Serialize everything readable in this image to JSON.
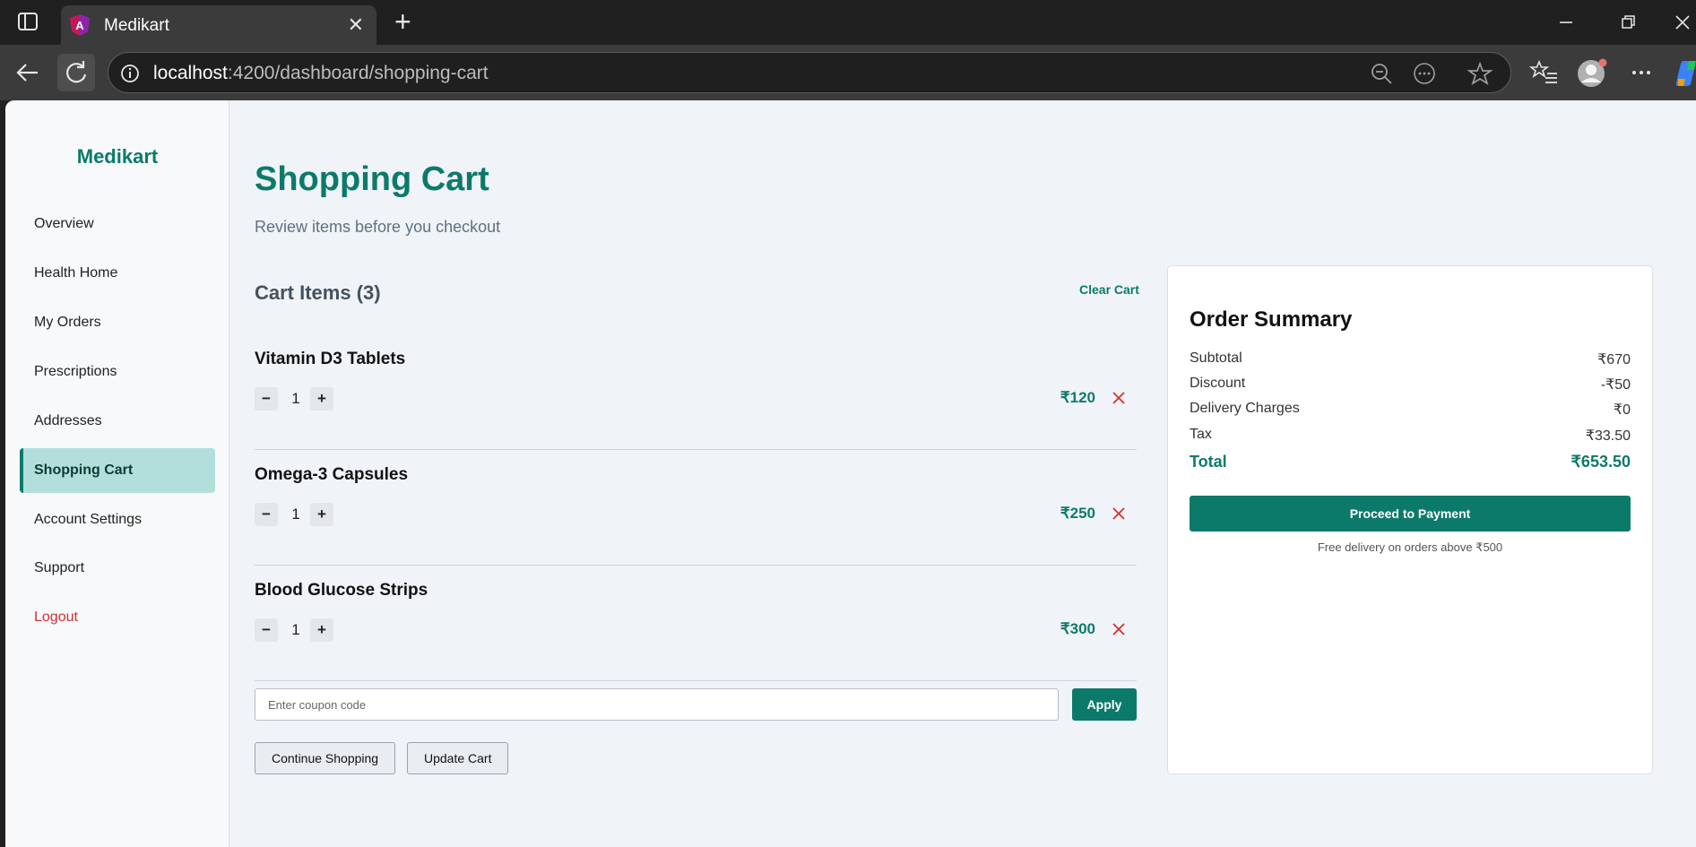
{
  "browser": {
    "tab_title": "Medikart",
    "url_host": "localhost",
    "url_path": ":4200/dashboard/shopping-cart"
  },
  "sidebar": {
    "brand": "Medikart",
    "items": [
      {
        "label": "Overview"
      },
      {
        "label": "Health Home"
      },
      {
        "label": "My Orders"
      },
      {
        "label": "Prescriptions"
      },
      {
        "label": "Addresses"
      },
      {
        "label": "Shopping Cart",
        "active": true
      },
      {
        "label": "Account Settings"
      },
      {
        "label": "Support"
      },
      {
        "label": "Logout"
      }
    ]
  },
  "main": {
    "title": "Shopping Cart",
    "subtitle": "Review items before you checkout",
    "cart_header": "Cart Items (3)",
    "clear_cart": "Clear Cart",
    "items": [
      {
        "name": "Vitamin D3 Tablets",
        "qty": "1",
        "price": "₹120"
      },
      {
        "name": "Omega-3 Capsules",
        "qty": "1",
        "price": "₹250"
      },
      {
        "name": "Blood Glucose Strips",
        "qty": "1",
        "price": "₹300"
      }
    ],
    "qty_minus": "−",
    "qty_plus": "+",
    "coupon_placeholder": "Enter coupon code",
    "apply": "Apply",
    "continue_shopping": "Continue Shopping",
    "update_cart": "Update Cart"
  },
  "summary": {
    "title": "Order Summary",
    "rows": [
      {
        "label": "Subtotal",
        "value": "₹670"
      },
      {
        "label": "Discount",
        "value": "-₹50"
      },
      {
        "label": "Delivery Charges",
        "value": "₹0"
      },
      {
        "label": "Tax",
        "value": "₹33.50"
      }
    ],
    "total_label": "Total",
    "total_value": "₹653.50",
    "pay_button": "Proceed to Payment",
    "free_note": "Free delivery on orders above ₹500"
  },
  "colors": {
    "brand": "#0c7a6a",
    "active_nav_bg": "#b2dfdb",
    "logout": "#d32f2f",
    "remove_icon": "#d32f2f"
  }
}
